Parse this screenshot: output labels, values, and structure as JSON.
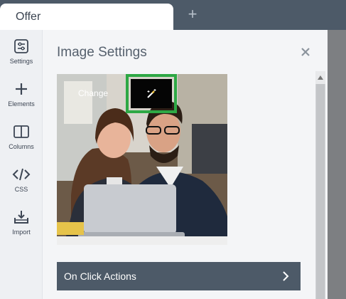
{
  "tabs": [
    {
      "label": "Offer"
    }
  ],
  "sidebar": {
    "items": [
      {
        "label": "Settings",
        "icon": "sliders-icon"
      },
      {
        "label": "Elements",
        "icon": "plus-icon"
      },
      {
        "label": "Columns",
        "icon": "columns-icon"
      },
      {
        "label": "CSS",
        "icon": "code-icon"
      },
      {
        "label": "Import",
        "icon": "import-icon"
      }
    ]
  },
  "panel": {
    "title": "Image Settings",
    "image": {
      "change_label": "Change",
      "magic_icon": "magic-wand-icon"
    },
    "action": {
      "label": "On Click Actions"
    }
  },
  "colors": {
    "header": "#4d5a68",
    "highlight": "#2ea845",
    "panel_bg": "#f4f5f7"
  }
}
